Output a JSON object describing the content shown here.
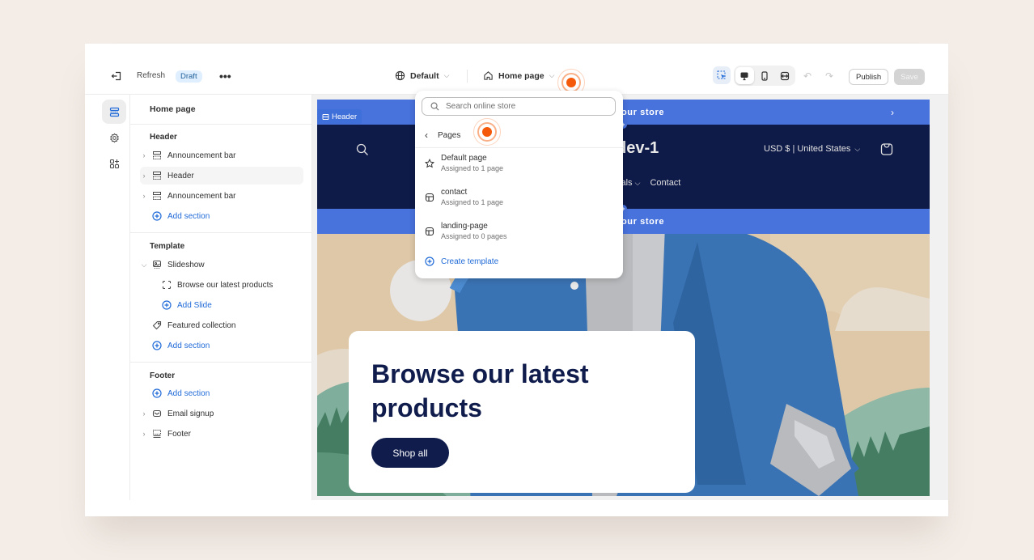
{
  "colors": {
    "background": "#f4ede7",
    "accent_link": "#1f6ad8",
    "announcement_bar": "#4872dc",
    "store_header": "#0e1a48",
    "hero_text": "#0f1c4c",
    "cursor_marker": "#f55a0a",
    "draft_badge_bg": "#e0efff"
  },
  "topbar": {
    "exit_icon": "exit-icon",
    "refresh_label": "Refresh",
    "status_badge": "Draft",
    "more_icon": "more-horizontal-icon",
    "more_label": "•••",
    "theme_selector": {
      "icon": "globe-icon",
      "label": "Default"
    },
    "page_selector": {
      "icon": "home-icon",
      "label": "Home page"
    },
    "inspector_icon": "select-element-icon",
    "device_toggle": [
      {
        "name": "desktop",
        "icon": "desktop-icon",
        "active": true
      },
      {
        "name": "mobile",
        "icon": "mobile-icon",
        "active": false
      },
      {
        "name": "fullwidth",
        "icon": "fullscreen-icon",
        "active": false
      }
    ],
    "undo_label": "↶",
    "redo_label": "↷",
    "publish_label": "Publish",
    "save_label": "Save"
  },
  "rail": [
    {
      "name": "sections",
      "icon": "sections-icon",
      "active": true
    },
    {
      "name": "theme-settings",
      "icon": "gear-icon",
      "active": false
    },
    {
      "name": "apps",
      "icon": "app-blocks-icon",
      "active": false
    }
  ],
  "sidebar": {
    "title": "Home page",
    "groups": {
      "header": {
        "label": "Header",
        "items": [
          {
            "label": "Announcement bar",
            "icon": "section-icon",
            "expandable": true
          },
          {
            "label": "Header",
            "icon": "section-icon",
            "expandable": true,
            "highlighted": true
          },
          {
            "label": "Announcement bar",
            "icon": "section-icon",
            "expandable": true
          }
        ],
        "add_label": "Add section"
      },
      "template": {
        "label": "Template",
        "slideshow": {
          "label": "Slideshow",
          "icon": "slideshow-icon",
          "expanded": true
        },
        "slide": {
          "label": "Browse our latest products",
          "icon": "slide-block-icon"
        },
        "add_slide_label": "Add Slide",
        "featured": {
          "label": "Featured collection",
          "icon": "tag-icon"
        },
        "add_label": "Add section"
      },
      "footer": {
        "label": "Footer",
        "add_label": "Add section",
        "items": [
          {
            "label": "Email signup",
            "icon": "email-icon",
            "expandable": true
          },
          {
            "label": "Footer",
            "icon": "footer-icon",
            "expandable": true
          }
        ]
      }
    }
  },
  "preview": {
    "announcement_text": "o our store",
    "announcement_next": "›",
    "header_tag": "Header",
    "store_name": "dev-1",
    "currency": "USD $ | United States",
    "nav": [
      "vals",
      "Contact"
    ],
    "hero": {
      "title": "Browse our latest products",
      "button": "Shop all"
    }
  },
  "dropdown": {
    "search_placeholder": "Search online store",
    "back_label": "Pages",
    "items": [
      {
        "name": "Default page",
        "sub": "Assigned to 1 page",
        "icon": "star-icon"
      },
      {
        "name": "contact",
        "sub": "Assigned to 1 page",
        "icon": "template-icon"
      },
      {
        "name": "landing-page",
        "sub": "Assigned to 0 pages",
        "icon": "template-icon"
      }
    ],
    "create_label": "Create template"
  }
}
